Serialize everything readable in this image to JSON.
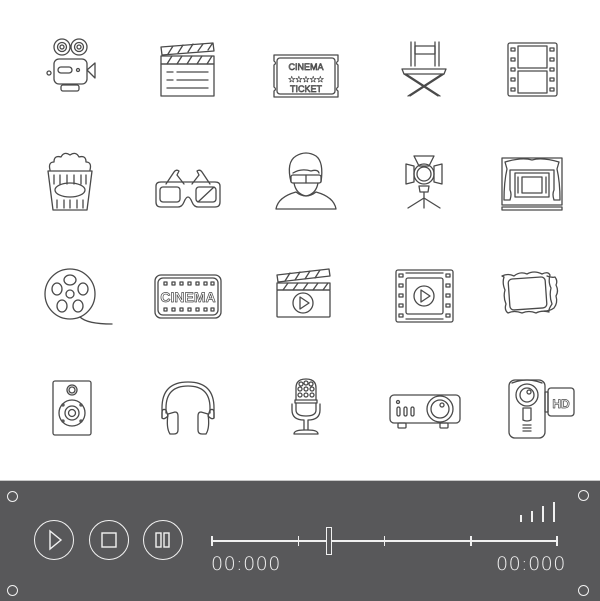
{
  "icons": [
    {
      "name": "movie-camera-icon"
    },
    {
      "name": "clapperboard-icon"
    },
    {
      "name": "cinema-ticket-icon",
      "line1": "CINEMA",
      "line2": "TICKET",
      "stars": 5
    },
    {
      "name": "director-chair-icon"
    },
    {
      "name": "film-strip-icon"
    },
    {
      "name": "popcorn-icon"
    },
    {
      "name": "3d-glasses-icon"
    },
    {
      "name": "viewer-3d-glasses-icon"
    },
    {
      "name": "spotlight-icon"
    },
    {
      "name": "cinema-stage-icon"
    },
    {
      "name": "film-reel-icon"
    },
    {
      "name": "cinema-sign-icon",
      "label": "CINEMA"
    },
    {
      "name": "clapperboard-play-icon"
    },
    {
      "name": "film-play-icon"
    },
    {
      "name": "photos-icon"
    },
    {
      "name": "speaker-icon"
    },
    {
      "name": "headphones-icon"
    },
    {
      "name": "microphone-icon"
    },
    {
      "name": "projector-icon"
    },
    {
      "name": "hd-camcorder-icon",
      "badge": "HD"
    }
  ],
  "player": {
    "background": "#58585a",
    "buttons": [
      {
        "name": "play-button",
        "icon": "play-icon"
      },
      {
        "name": "stop-button",
        "icon": "stop-icon"
      },
      {
        "name": "pause-button",
        "icon": "pause-icon"
      }
    ],
    "progress": 0.34,
    "timeline_ticks": 5,
    "elapsed": "00:000",
    "total": "00:000",
    "volume_level": 4,
    "volume_max": 4
  }
}
